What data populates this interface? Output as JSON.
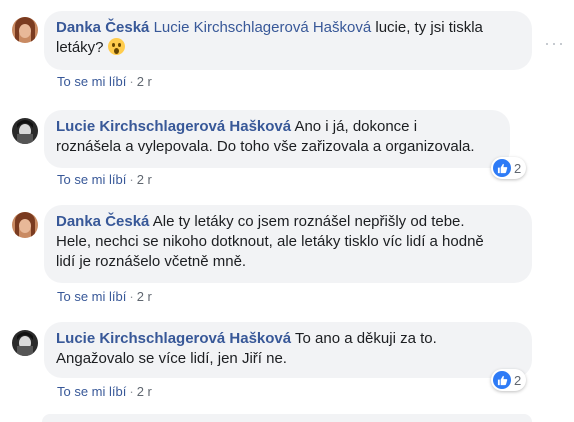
{
  "comments": [
    {
      "author": "Danka Česká",
      "mention": "Lucie Kirchschlagerová Hašková",
      "text_after_mention": " lucie, ty jsi tiskla",
      "line2": "letáky? ",
      "emoji": "astonished-face",
      "like_label": "To se mi líbí",
      "separator": "·",
      "time": "2 r"
    },
    {
      "author": "Lucie Kirchschlagerová Hašková",
      "line1": " Ano i já, dokonce i",
      "line2": "roznášela a vylepovala. Do toho vše zařizovala a organizovala.",
      "like_label": "To se mi líbí",
      "separator": "·",
      "time": "2 r",
      "reaction_count": "2"
    },
    {
      "author": "Danka Česká",
      "line1": " Ale ty letáky co jsem roznášel nepřišly od tebe.",
      "line2": "Hele, nechci se nikoho dotknout, ale letáky tisklo víc lidí a hodně",
      "line3": "lidí je roznášelo včetně mně.",
      "like_label": "To se mi líbí",
      "separator": "·",
      "time": "2 r"
    },
    {
      "author": "Lucie Kirchschlagerová Hašková",
      "line1": " To ano a děkuji za to.",
      "line2": "Angažovalo se více lidí, jen Jiří ne.",
      "like_label": "To se mi líbí",
      "separator": "·",
      "time": "2 r",
      "reaction_count": "2"
    }
  ],
  "more_options_glyph": "···",
  "colors": {
    "link": "#385898",
    "bubble": "#f2f3f5",
    "like_blue": "#2e7bf6"
  }
}
